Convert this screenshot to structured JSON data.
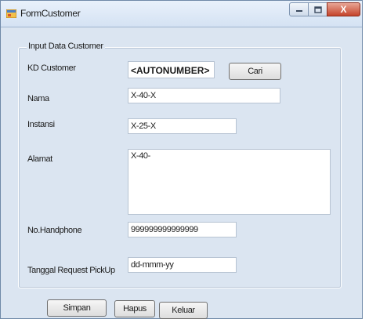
{
  "window": {
    "title": "FormCustomer",
    "close_glyph": "X"
  },
  "group": {
    "label": "Input Data Customer"
  },
  "fields": {
    "kd_customer": {
      "label": "KD Customer",
      "value": "<AUTONUMBER>"
    },
    "nama": {
      "label": "Nama",
      "value": "X-40-X"
    },
    "instansi": {
      "label": "Instansi",
      "value": "X-25-X"
    },
    "alamat": {
      "label": "Alamat",
      "value": "X-40-"
    },
    "handphone": {
      "label": "No.Handphone",
      "value": "999999999999999"
    },
    "tanggal": {
      "label": "Tanggal Request PickUp",
      "value": "dd-mmm-yy"
    }
  },
  "buttons": {
    "cari": "Cari",
    "simpan": "Simpan",
    "hapus": "Hapus",
    "keluar": "Keluar"
  },
  "icons": {
    "app": "form-app-icon",
    "minimize": "minimize-icon",
    "maximize": "maximize-icon",
    "close": "close-icon"
  },
  "colors": {
    "form_bg": "#dbe5f1",
    "close_button": "#c5442b"
  }
}
